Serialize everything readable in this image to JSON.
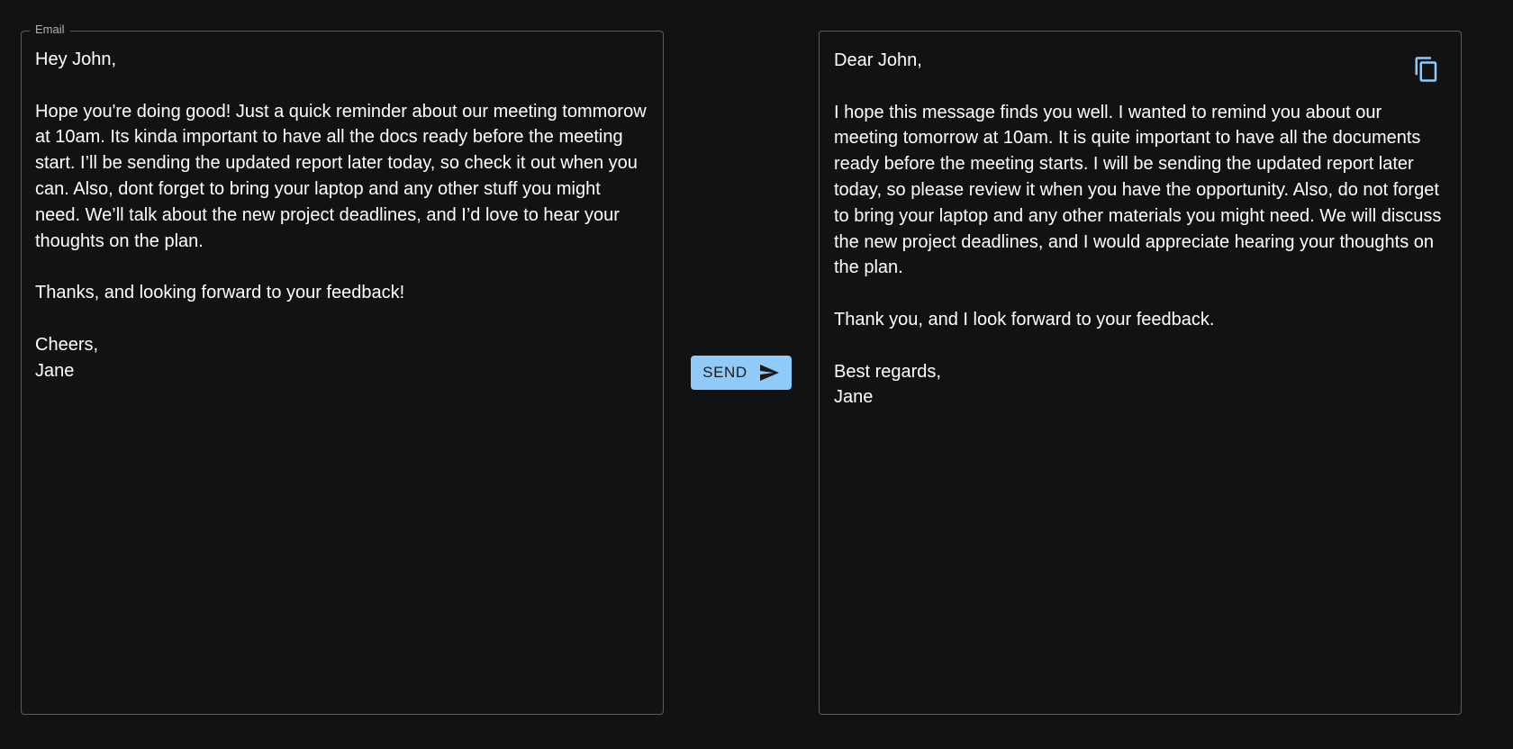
{
  "input_field": {
    "label": "Email",
    "value": "Hey John,\n\nHope you're doing good! Just a quick reminder about our meeting tommorow at 10am. Its kinda important to have all the docs ready before the meeting start. I’ll be sending the updated report later today, so check it out when you can. Also, dont forget to bring your laptop and any other stuff you might need. We’ll talk about the new project deadlines, and I’d love to hear your thoughts on the plan.\n\nThanks, and looking forward to your feedback!\n\nCheers,\nJane"
  },
  "send_button": {
    "label": "SEND",
    "icon": "send-icon",
    "color": "#90caf9"
  },
  "output": {
    "text": "Dear John,\n\nI hope this message finds you well. I wanted to remind you about our meeting tomorrow at 10am. It is quite important to have all the documents ready before the meeting starts. I will be sending the updated report later today, so please review it when you have the opportunity. Also, do not forget to bring your laptop and any other materials you might need. We will discuss the new project deadlines, and I would appreciate hearing your thoughts on the plan.\n\nThank you, and I look forward to your feedback.\n\nBest regards,\nJane",
    "copy_icon": "copy-icon"
  },
  "colors": {
    "background": "#121212",
    "border": "#5a5a5a",
    "accent": "#90caf9",
    "text": "#ffffff"
  }
}
